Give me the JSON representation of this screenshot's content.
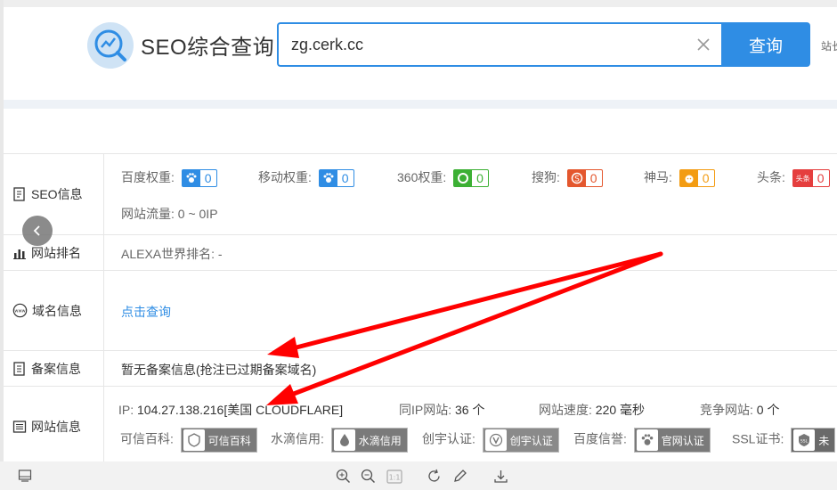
{
  "header": {
    "logo_text": "SEO综合查询",
    "search_value": "zg.cerk.cc",
    "search_button": "查询",
    "cut_text": "站长"
  },
  "rows": {
    "seo": {
      "label": "SEO信息",
      "baidu_label": "百度权重:",
      "baidu_value": "0",
      "mobile_label": "移动权重:",
      "mobile_value": "0",
      "q360_label": "360权重:",
      "q360_value": "0",
      "sogou_label": "搜狗:",
      "sogou_value": "0",
      "shenma_label": "神马:",
      "shenma_value": "0",
      "toutiao_label": "头条:",
      "toutiao_value": "0",
      "toutiao_icon_text": "头条",
      "traffic": "网站流量: 0 ~ 0IP"
    },
    "rank": {
      "label": "网站排名",
      "alexa": "ALEXA世界排名: -"
    },
    "domain": {
      "label": "域名信息",
      "link": "点击查询"
    },
    "icp": {
      "label": "备案信息",
      "text": "暂无备案信息(抢注已过期备案域名)"
    },
    "site": {
      "label": "网站信息",
      "ip_label": "IP:",
      "ip_value": "104.27.138.216[美国 CLOUDFLARE]",
      "sameip_label": "同IP网站:",
      "sameip_value": "36 个",
      "speed_label": "网站速度:",
      "speed_value": "220 毫秒",
      "compete_label": "竞争网站:",
      "compete_value": "0 个",
      "kexin_label": "可信百科:",
      "kexin_badge": "可信百科",
      "shuidi_label": "水滴信用:",
      "shuidi_badge": "水滴信用",
      "chuangyu_label": "创宇认证:",
      "chuangyu_badge": "创宇认证",
      "baidu_xy_label": "百度信誉:",
      "baidu_xy_badge": "官网认证",
      "ssl_label": "SSL证书:",
      "ssl_badge": "未"
    }
  },
  "colors": {
    "accent": "#2f8de4",
    "sogou": "#e4572e",
    "q360": "#3cb034",
    "shenma": "#f39c12",
    "toutiao": "#e53e3e",
    "arrow": "#ff0000"
  },
  "icons": [
    "logo-chart-icon",
    "clear-icon",
    "back-chevron-icon",
    "paw-icon",
    "360-icon",
    "sogou-icon",
    "shenma-icon",
    "toutiao-icon",
    "document-icon",
    "bar-chart-icon",
    "www-icon",
    "list-icon",
    "zoom-in-icon",
    "zoom-out-icon",
    "rotate-icon",
    "edit-icon",
    "download-icon",
    "screen-icon"
  ]
}
